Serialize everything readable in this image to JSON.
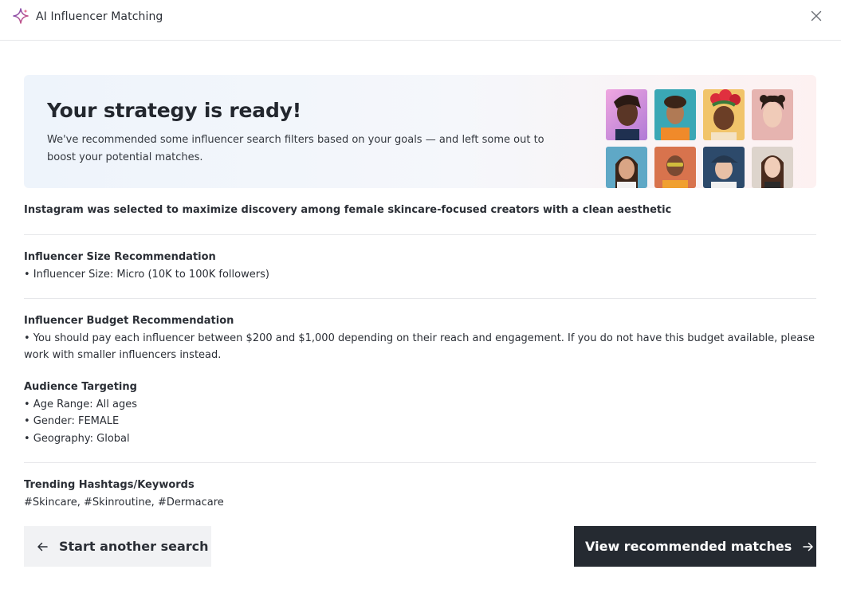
{
  "header": {
    "title": "AI Influencer Matching",
    "icon": "sparkle-icon",
    "close_icon": "close-icon"
  },
  "hero": {
    "title": "Your strategy is ready!",
    "description": "We've recommended some influencer search filters based on your goals — and left some out to boost your potential matches.",
    "avatar_colors": [
      "#e8a3d6",
      "#3aa7b5",
      "#f1c46a",
      "#e6b4b0",
      "#5fa8c6",
      "#d8734d",
      "#2d4a6b",
      "#ddd4cc"
    ]
  },
  "platform_note": "Instagram was selected to maximize discovery among female skincare-focused creators with a clean aesthetic",
  "size": {
    "heading": "Influencer Size Recommendation",
    "item": "• Influencer Size: Micro (10K to 100K followers)"
  },
  "budget": {
    "heading": "Influencer Budget Recommendation",
    "item": "• You should pay each influencer between $200 and $1,000 depending on their reach and engagement. If you do not have this budget available, please work with smaller influencers instead."
  },
  "audience": {
    "heading": "Audience Targeting",
    "items": [
      "• Age Range: All ages",
      "• Gender: FEMALE",
      "• Geography: Global"
    ]
  },
  "hashtags": {
    "heading": "Trending Hashtags/Keywords",
    "value": "#Skincare, #Skinroutine, #Dermacare"
  },
  "actions": {
    "secondary_label": "Start another search",
    "primary_label": "View recommended matches"
  },
  "colors": {
    "primary_button": "#252a31",
    "secondary_button": "#f1f2f4",
    "accent_purple": "#6b4fbb",
    "accent_pink": "#e0567a"
  }
}
